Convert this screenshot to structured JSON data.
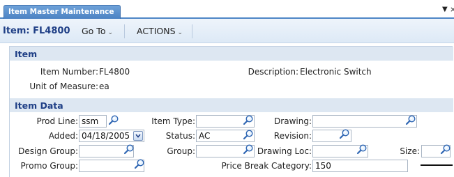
{
  "tab": {
    "title": "Item Master Maintenance"
  },
  "toolbar": {
    "item_title": "Item: FL4800",
    "goto_label": "Go To",
    "actions_label": "ACTIONS"
  },
  "item_section": {
    "header": "Item",
    "item_number_label": "Item Number:",
    "item_number_value": "FL4800",
    "description_label": "Description:",
    "description_value": "Electronic Switch",
    "uom_label": "Unit of Measure:",
    "uom_value": "ea"
  },
  "item_data_section": {
    "header": "Item Data",
    "prod_line_label": "Prod Line:",
    "prod_line_value": "ssm",
    "item_type_label": "Item Type:",
    "item_type_value": "",
    "drawing_label": "Drawing:",
    "drawing_value": "",
    "added_label": "Added:",
    "added_value": "04/18/2005",
    "status_label": "Status:",
    "status_value": "AC",
    "revision_label": "Revision:",
    "revision_value": "",
    "design_group_label": "Design Group:",
    "design_group_value": "",
    "group_label": "Group:",
    "group_value": "",
    "drawing_loc_label": "Drawing Loc:",
    "drawing_loc_value": "",
    "size_label": "Size:",
    "size_value": "",
    "promo_group_label": "Promo Group:",
    "promo_group_value": "",
    "price_break_label": "Price Break Category:",
    "price_break_value": "150"
  },
  "icons": {
    "lookup": "magnifier-icon",
    "dropdown": "chevron-down-icon",
    "menu_arrow": "triangle-down-icon",
    "close": "close-icon"
  },
  "colors": {
    "tab_blue": "#4b82c3",
    "title_navy": "#1f3f86",
    "section_bg": "#dde7f2",
    "toolbar_bg": "#e6eef8"
  }
}
